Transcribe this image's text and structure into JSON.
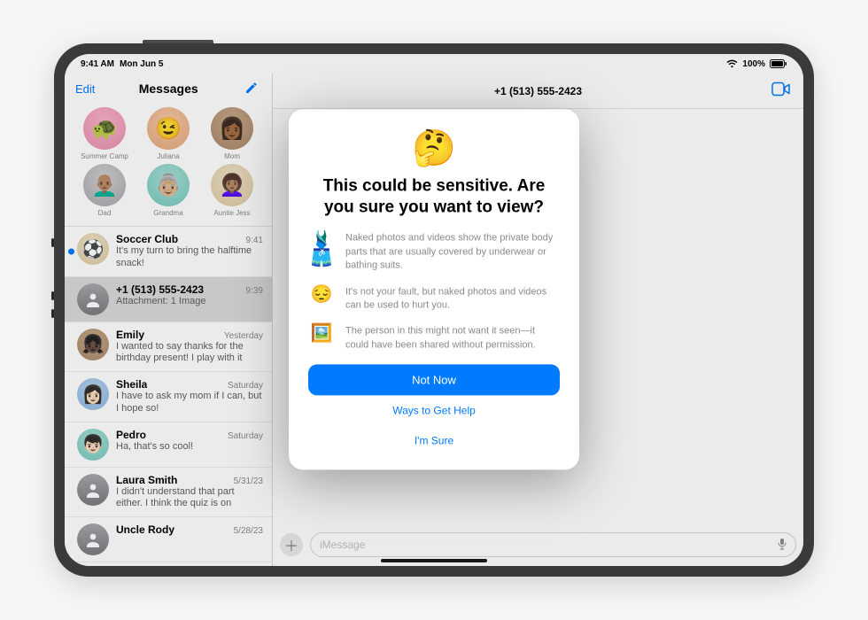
{
  "status": {
    "time": "9:41 AM",
    "date": "Mon Jun 5",
    "battery": "100%"
  },
  "sidebar": {
    "edit": "Edit",
    "title": "Messages"
  },
  "pins": [
    {
      "label": "Summer Camp",
      "emoji": "🐢",
      "bg": "bg-pink"
    },
    {
      "label": "Juliana",
      "emoji": "😉",
      "bg": "bg-peach"
    },
    {
      "label": "Mom",
      "emoji": "👩🏾",
      "bg": "bg-brown"
    },
    {
      "label": "Dad",
      "emoji": "👨🏽‍🦲",
      "bg": "bg-gray"
    },
    {
      "label": "Grandma",
      "emoji": "👵🏼",
      "bg": "bg-teal"
    },
    {
      "label": "Auntie Jess",
      "emoji": "👩🏽‍🦱",
      "bg": "bg-cream"
    }
  ],
  "conversations": [
    {
      "name": "Soccer Club",
      "time": "9:41",
      "preview": "It's my turn to bring the halftime snack!",
      "unread": true,
      "avatar": "⚽",
      "bg": "bg-cream"
    },
    {
      "name": "+1 (513) 555-2423",
      "time": "9:39",
      "preview": "Attachment: 1 Image",
      "selected": true,
      "avatar": "",
      "bg": "bg-generic"
    },
    {
      "name": "Emily",
      "time": "Yesterday",
      "preview": "I wanted to say thanks for the birthday present! I play with it every day in the yard!",
      "avatar": "👧🏿",
      "bg": "bg-brown"
    },
    {
      "name": "Sheila",
      "time": "Saturday",
      "preview": "I have to ask my mom if I can, but I hope so!",
      "avatar": "👩🏻",
      "bg": "bg-blue"
    },
    {
      "name": "Pedro",
      "time": "Saturday",
      "preview": "Ha, that's so cool!",
      "avatar": "👦🏻",
      "bg": "bg-teal"
    },
    {
      "name": "Laura Smith",
      "time": "5/31/23",
      "preview": "I didn't understand that part either. I think the quiz is on Thursday now.",
      "avatar": "",
      "bg": "bg-generic"
    },
    {
      "name": "Uncle Rody",
      "time": "5/28/23",
      "preview": "",
      "avatar": "",
      "bg": "bg-generic"
    }
  ],
  "main": {
    "title": "+1 (513) 555-2423",
    "placeholder": "iMessage"
  },
  "modal": {
    "emoji": "🤔",
    "title": "This could be sensitive. Are you sure you want to view?",
    "items": [
      {
        "icon": "🩱🩳",
        "text": "Naked photos and videos show the private body parts that are usually covered by underwear or bathing suits."
      },
      {
        "icon": "😔",
        "text": "It's not your fault, but naked photos and videos can be used to hurt you."
      },
      {
        "icon": "🖼️",
        "text": "The person in this might not want it seen—it could have been shared without permission."
      }
    ],
    "primary": "Not Now",
    "link1": "Ways to Get Help",
    "link2": "I'm Sure"
  }
}
